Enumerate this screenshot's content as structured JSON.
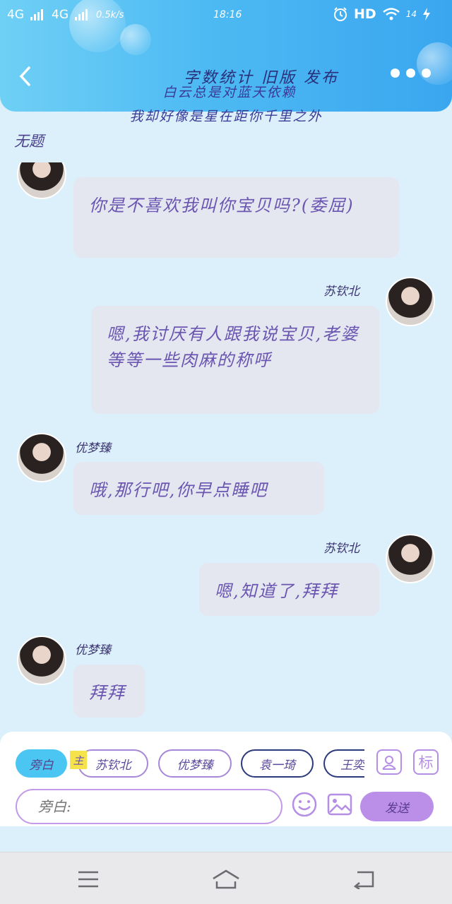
{
  "status_bar": {
    "network1": "4G",
    "network2": "4G",
    "speed": "0.5k/s",
    "time": "18:16",
    "hd": "HD",
    "battery": "14"
  },
  "header": {
    "title": "字数统计  旧版  发布",
    "marquee_line1": "白云总是对蓝天依赖",
    "marquee_line2": "我却好像是星在距你千里之外"
  },
  "chat": {
    "subject": "无题",
    "messages": [
      {
        "side": "left",
        "sender": "",
        "text": "你是不喜欢我叫你宝贝吗?(委屈)"
      },
      {
        "side": "right",
        "sender": "苏钦北",
        "text": "嗯,我讨厌有人跟我说宝贝,老婆等等一些肉麻的称呼"
      },
      {
        "side": "left",
        "sender": "优梦臻",
        "text": "哦,那行吧,你早点睡吧"
      },
      {
        "side": "right",
        "sender": "苏钦北",
        "text": "嗯,知道了,拜拜"
      },
      {
        "side": "left",
        "sender": "优梦臻",
        "text": "拜拜"
      }
    ]
  },
  "composer": {
    "narration_chip": "旁白",
    "role_tag": "主",
    "role_chips": [
      "苏钦北",
      "优梦臻",
      "袁一琦",
      "王奕"
    ],
    "mark_button": "标",
    "input_placeholder": "旁白:",
    "send_label": "发送"
  },
  "colors": {
    "header_start": "#6fd0f5",
    "header_end": "#3aa6ef",
    "background": "#dcf0fb",
    "bubble": "#e4e6f0",
    "accent_purple": "#bb8ee8",
    "narration_blue": "#4bc6f2"
  },
  "icons": {
    "back": "chevron-left-icon",
    "more": "more-dots-icon",
    "profile": "person-card-icon",
    "emoji": "smiley-icon",
    "image": "image-icon",
    "nav_menu": "menu-icon",
    "nav_home": "home-icon",
    "nav_back": "return-icon"
  }
}
